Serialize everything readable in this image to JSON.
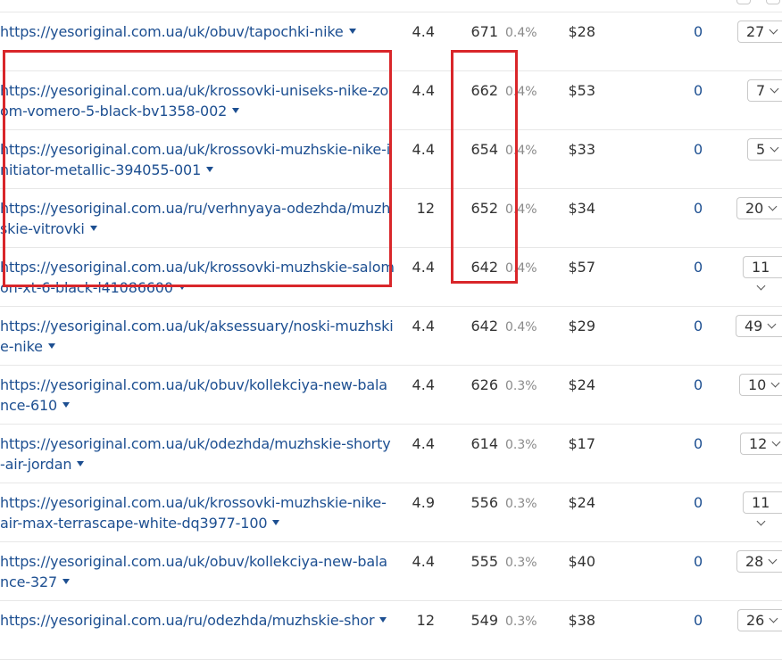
{
  "rows": [
    {
      "url": "https://yesoriginal.com.ua/uk/obuv/tapochki-nike",
      "kd": "4.4",
      "volume": "671",
      "share": "0.4%",
      "cpc": "$28",
      "count": "0",
      "rank": "27"
    },
    {
      "url": "https://yesoriginal.com.ua/uk/krossovki-uniseks-nike-zoom-vomero-5-black-bv1358-002",
      "kd": "4.4",
      "volume": "662",
      "share": "0.4%",
      "cpc": "$53",
      "count": "0",
      "rank": "7"
    },
    {
      "url": "https://yesoriginal.com.ua/uk/krossovki-muzhskie-nike-initiator-metallic-394055-001",
      "kd": "4.4",
      "volume": "654",
      "share": "0.4%",
      "cpc": "$33",
      "count": "0",
      "rank": "5"
    },
    {
      "url": "https://yesoriginal.com.ua/ru/verhnyaya-odezhda/muzhskie-vitrovki",
      "kd": "12",
      "volume": "652",
      "share": "0.4%",
      "cpc": "$34",
      "count": "0",
      "rank": "20"
    },
    {
      "url": "https://yesoriginal.com.ua/uk/krossovki-muzhskie-salomon-xt-6-black-l41086600",
      "kd": "4.4",
      "volume": "642",
      "share": "0.4%",
      "cpc": "$57",
      "count": "0",
      "rank": "11"
    },
    {
      "url": "https://yesoriginal.com.ua/uk/aksessuary/noski-muzhskie-nike",
      "kd": "4.4",
      "volume": "642",
      "share": "0.4%",
      "cpc": "$29",
      "count": "0",
      "rank": "49"
    },
    {
      "url": "https://yesoriginal.com.ua/uk/obuv/kollekciya-new-balance-610",
      "kd": "4.4",
      "volume": "626",
      "share": "0.3%",
      "cpc": "$24",
      "count": "0",
      "rank": "10"
    },
    {
      "url": "https://yesoriginal.com.ua/uk/odezhda/muzhskie-shorty-air-jordan",
      "kd": "4.4",
      "volume": "614",
      "share": "0.3%",
      "cpc": "$17",
      "count": "0",
      "rank": "12"
    },
    {
      "url": "https://yesoriginal.com.ua/uk/krossovki-muzhskie-nike-air-max-terrascape-white-dq3977-100",
      "kd": "4.9",
      "volume": "556",
      "share": "0.3%",
      "cpc": "$24",
      "count": "0",
      "rank": "11"
    },
    {
      "url": "https://yesoriginal.com.ua/uk/obuv/kollekciya-new-balance-327",
      "kd": "4.4",
      "volume": "555",
      "share": "0.3%",
      "cpc": "$40",
      "count": "0",
      "rank": "28"
    },
    {
      "url": "https://yesoriginal.com.ua/ru/odezhda/muzhskie-shor",
      "kd": "12",
      "volume": "549",
      "share": "0.3%",
      "cpc": "$38",
      "count": "0",
      "rank": "26"
    }
  ],
  "highlight_color": "#d9262a",
  "link_color": "#1d4f91"
}
